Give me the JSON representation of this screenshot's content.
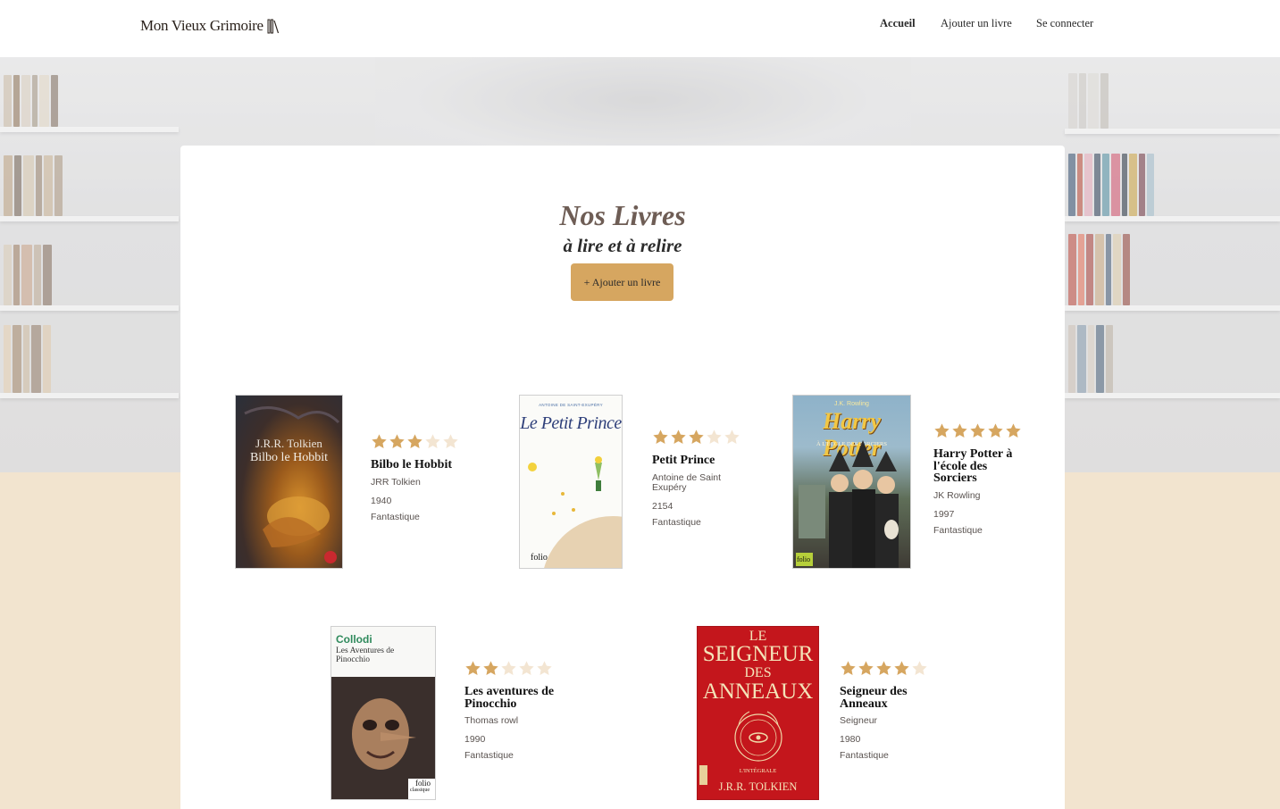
{
  "header": {
    "logo_text": "Mon Vieux Grimoire",
    "nav": {
      "home": "Accueil",
      "add_book": "Ajouter un livre",
      "login": "Se connecter"
    }
  },
  "main": {
    "title": "Nos Livres",
    "subtitle": "à lire et à relire",
    "add_button": "+ Ajouter un livre"
  },
  "colors": {
    "accent": "#d6a660",
    "star_filled": "#d6a660",
    "star_empty": "#f3e5d2",
    "page_background": "#f2e4cf"
  },
  "books": [
    {
      "title": "Bilbo le Hobbit",
      "author": "JRR Tolkien",
      "year": "1940",
      "genre": "Fantastique",
      "rating": 3,
      "cover": {
        "author": "J.R.R. Tolkien",
        "title": "Bilbo le Hobbit"
      }
    },
    {
      "title": "Petit Prince",
      "author": "Antoine de Saint Exupéry",
      "year": "2154",
      "genre": "Fantastique",
      "rating": 3,
      "cover": {
        "author": "ANTOINE DE SAINT-EXUPÉRY",
        "title": "Le Petit Prince",
        "publisher": "folio"
      }
    },
    {
      "title": "Harry Potter à l'école des Sorciers",
      "author": "JK Rowling",
      "year": "1997",
      "genre": "Fantastique",
      "rating": 5,
      "cover": {
        "author": "J.K. Rowling",
        "title": "Harry Potter",
        "subtitle": "À L'ÉCOLE DES SORCIERS",
        "publisher": "folio"
      }
    },
    {
      "title": "Les aventures de Pinocchio",
      "author": "Thomas rowl",
      "year": "1990",
      "genre": "Fantastique",
      "rating": 2,
      "cover": {
        "author": "Collodi",
        "title": "Les Aventures de Pinocchio",
        "publisher": "folio",
        "series": "classique"
      }
    },
    {
      "title": "Seigneur des Anneaux",
      "author": "Seigneur",
      "year": "1980",
      "genre": "Fantastique",
      "rating": 4,
      "cover": {
        "title_line1": "LE",
        "title_line2": "SEIGNEUR",
        "title_line3": "DES",
        "title_line4": "ANNEAUX",
        "edition": "L'INTÉGRALE",
        "author": "J.R.R. TOLKIEN"
      }
    }
  ]
}
